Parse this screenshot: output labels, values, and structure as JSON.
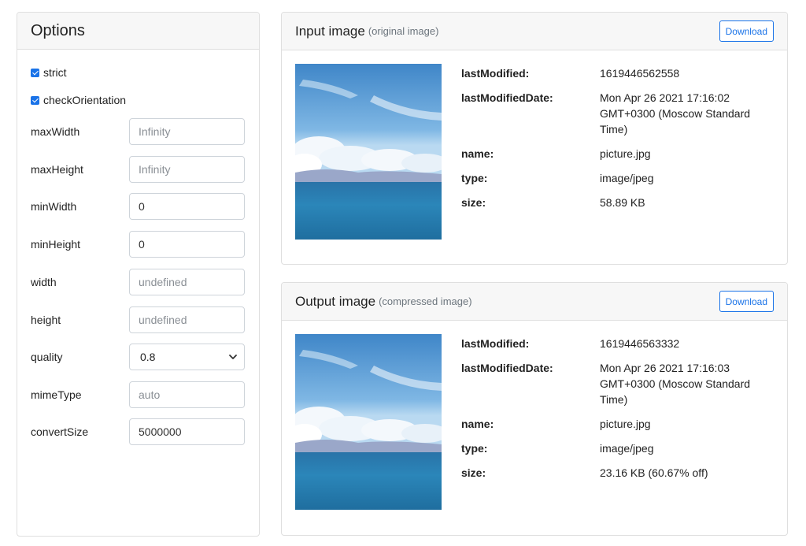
{
  "options": {
    "title": "Options",
    "checkboxes": [
      {
        "label": "strict",
        "checked": true
      },
      {
        "label": "checkOrientation",
        "checked": true
      }
    ],
    "fields": [
      {
        "label": "maxWidth",
        "value": "",
        "placeholder": "Infinity"
      },
      {
        "label": "maxHeight",
        "value": "",
        "placeholder": "Infinity"
      },
      {
        "label": "minWidth",
        "value": "0",
        "placeholder": ""
      },
      {
        "label": "minHeight",
        "value": "0",
        "placeholder": ""
      },
      {
        "label": "width",
        "value": "",
        "placeholder": "undefined"
      },
      {
        "label": "height",
        "value": "",
        "placeholder": "undefined"
      },
      {
        "label": "quality",
        "selected": "0.8"
      },
      {
        "label": "mimeType",
        "value": "",
        "placeholder": "auto"
      },
      {
        "label": "convertSize",
        "value": "5000000",
        "placeholder": ""
      }
    ]
  },
  "input_card": {
    "title": "Input image",
    "subtitle": "(original image)",
    "download_label": "Download",
    "meta": [
      {
        "key": "lastModified:",
        "value": "1619446562558"
      },
      {
        "key": "lastModifiedDate:",
        "value": "Mon Apr 26 2021 17:16:02 GMT+0300 (Moscow Standard Time)"
      },
      {
        "key": "name:",
        "value": "picture.jpg"
      },
      {
        "key": "type:",
        "value": "image/jpeg"
      },
      {
        "key": "size:",
        "value": "58.89 KB"
      }
    ]
  },
  "output_card": {
    "title": "Output image",
    "subtitle": "(compressed image)",
    "download_label": "Download",
    "meta": [
      {
        "key": "lastModified:",
        "value": "1619446563332"
      },
      {
        "key": "lastModifiedDate:",
        "value": "Mon Apr 26 2021 17:16:03 GMT+0300 (Moscow Standard Time)"
      },
      {
        "key": "name:",
        "value": "picture.jpg"
      },
      {
        "key": "type:",
        "value": "image/jpeg"
      },
      {
        "key": "size:",
        "value": "23.16 KB (60.67% off)"
      }
    ]
  },
  "colors": {
    "accent": "#1a73e8",
    "header_bg": "#f7f7f7",
    "border": "#dfdfdf"
  },
  "icons": {
    "select_arrow": "chevron-down-icon"
  }
}
